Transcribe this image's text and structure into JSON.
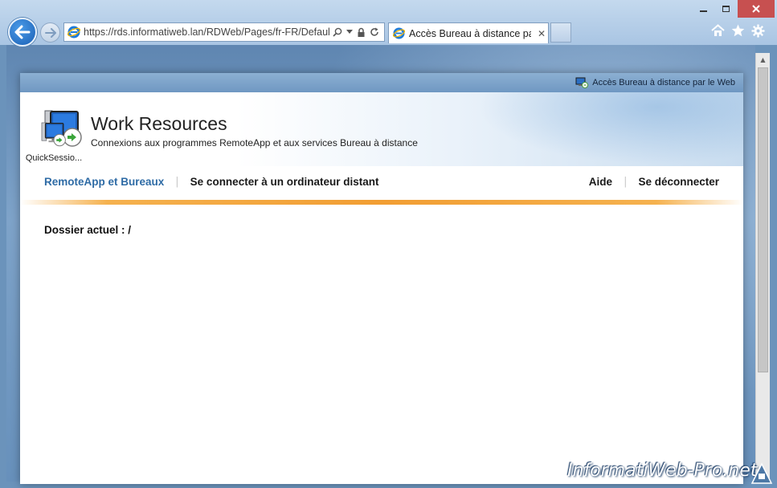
{
  "browser": {
    "url": "https://rds.informatiweb.lan/RDWeb/Pages/fr-FR/Default",
    "tab_title": "Accès Bureau à distance pa...",
    "tab_close": "✕",
    "window_min": "—",
    "window_max": "☐",
    "window_close": "✕"
  },
  "rdweb": {
    "top_link": "Accès Bureau à distance par le Web",
    "title": "Work Resources",
    "subtitle": "Connexions aux programmes RemoteApp et aux services Bureau à distance",
    "nav": {
      "remoteapp": "RemoteApp et Bureaux",
      "sep": "|",
      "connect": "Se connecter à un ordinateur distant",
      "help": "Aide",
      "logout": "Se déconnecter"
    },
    "current_folder": "Dossier actuel : /",
    "apps": [
      {
        "label": "QuickSessio..."
      }
    ]
  },
  "watermark": "InformatiWeb-Pro.net",
  "colors": {
    "accent_blue": "#2e6ba5",
    "orange_line": "#f0931c",
    "close_red": "#c75050"
  },
  "icons": [
    "back-arrow-icon",
    "forward-arrow-icon",
    "ie-logo-icon",
    "search-icon",
    "lock-icon",
    "refresh-icon",
    "home-icon",
    "favorites-star-icon",
    "settings-gear-icon",
    "remote-desktop-icon"
  ]
}
